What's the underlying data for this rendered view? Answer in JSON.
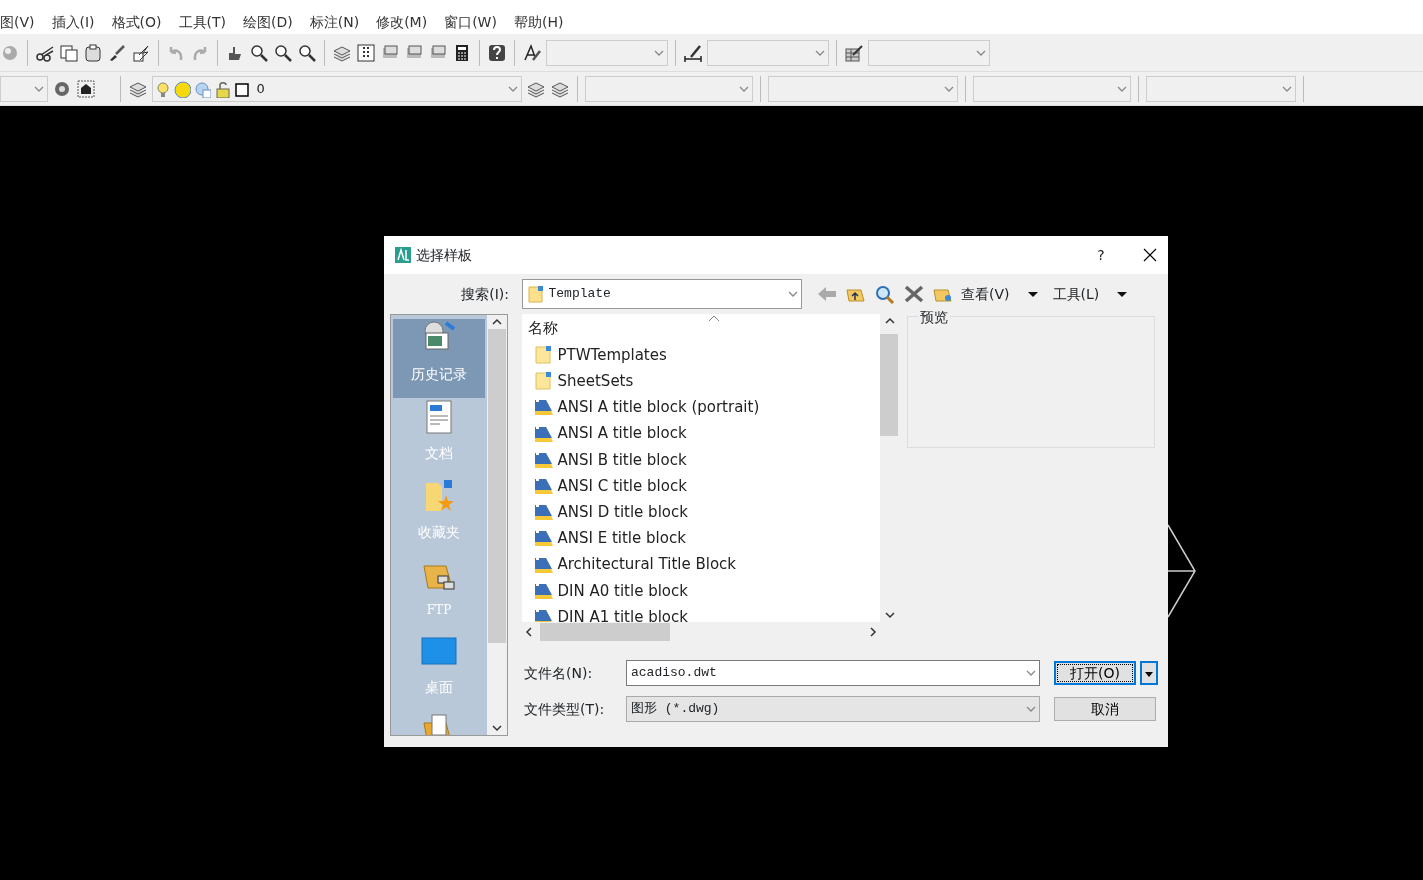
{
  "menu": [
    "图(V)",
    "插入(I)",
    "格式(O)",
    "工具(T)",
    "绘图(D)",
    "标注(N)",
    "修改(M)",
    "窗口(W)",
    "帮助(H)"
  ],
  "layer_combo": {
    "value": "0"
  },
  "dialog": {
    "title": "选择样板",
    "help": "?",
    "search_label": "搜索(I):",
    "search_value": "Template",
    "view_menu": "查看(V)",
    "tools_menu": "工具(L)",
    "places": [
      {
        "label": "历史记录",
        "kind": "history",
        "selected": true
      },
      {
        "label": "文档",
        "kind": "documents",
        "selected": false
      },
      {
        "label": "收藏夹",
        "kind": "favorites",
        "selected": false
      },
      {
        "label": "FTP",
        "kind": "ftp",
        "selected": false
      },
      {
        "label": "桌面",
        "kind": "desktop",
        "selected": false
      },
      {
        "kind": "folder",
        "selected": false
      }
    ],
    "list_header": "名称",
    "files": [
      {
        "name": "PTWTemplates",
        "kind": "folder"
      },
      {
        "name": "SheetSets",
        "kind": "folder"
      },
      {
        "name": "ANSI A title block (portrait)",
        "kind": "template"
      },
      {
        "name": "ANSI A title block",
        "kind": "template"
      },
      {
        "name": "ANSI B title block",
        "kind": "template"
      },
      {
        "name": "ANSI C title block",
        "kind": "template"
      },
      {
        "name": "ANSI D title block",
        "kind": "template"
      },
      {
        "name": "ANSI E title block",
        "kind": "template"
      },
      {
        "name": "Architectural Title Block",
        "kind": "template"
      },
      {
        "name": "DIN A0 title block",
        "kind": "template"
      },
      {
        "name": "DIN A1 title block",
        "kind": "template"
      }
    ],
    "preview_label": "预览",
    "filename_label": "文件名(N):",
    "filename_value": "acadiso.dwt",
    "filetype_label": "文件类型(T):",
    "filetype_value": "图形 (*.dwg)",
    "open_button": "打开(O)",
    "cancel_button": "取消"
  }
}
